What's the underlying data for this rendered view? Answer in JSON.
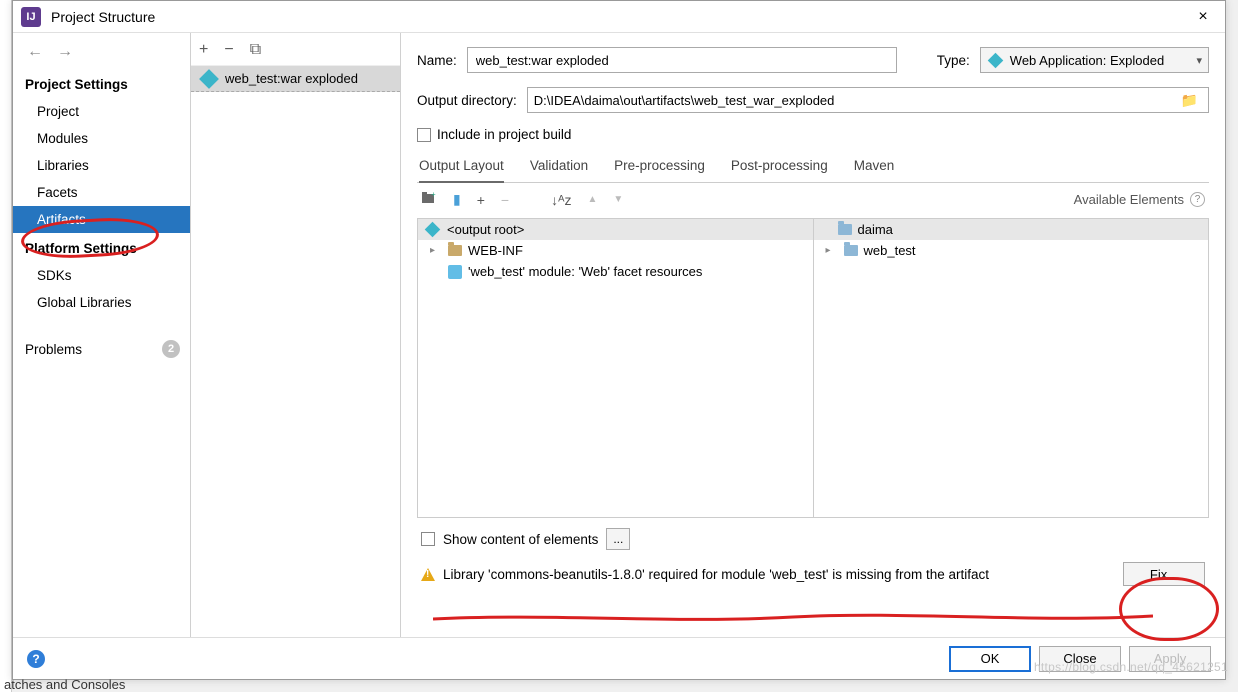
{
  "window": {
    "title": "Project Structure",
    "close": "×"
  },
  "sidebar": {
    "nav_back": "←",
    "nav_forward": "→",
    "group1_title": "Project Settings",
    "items1": [
      "Project",
      "Modules",
      "Libraries",
      "Facets",
      "Artifacts"
    ],
    "selected": "Artifacts",
    "group2_title": "Platform Settings",
    "items2": [
      "SDKs",
      "Global Libraries"
    ],
    "problems_label": "Problems",
    "problems_count": "2"
  },
  "mid": {
    "add": "+",
    "remove": "−",
    "copy": "⧉",
    "artifact_name": "web_test:war exploded"
  },
  "form": {
    "name_label": "Name:",
    "name_value": "web_test:war exploded",
    "type_label": "Type:",
    "type_value": "Web Application: Exploded",
    "outdir_label": "Output directory:",
    "outdir_value": "D:\\IDEA\\daima\\out\\artifacts\\web_test_war_exploded",
    "include_label": "Include in project build"
  },
  "tabs": {
    "items": [
      "Output Layout",
      "Validation",
      "Pre-processing",
      "Post-processing",
      "Maven"
    ],
    "active": "Output Layout"
  },
  "ol_toolbar": {
    "add_folder": "📁+",
    "jar": "▮",
    "add": "+",
    "remove": "−",
    "sort": "↓ᴬᴢ",
    "up": "▲",
    "down": "▼",
    "avail_label": "Available Elements",
    "help": "?"
  },
  "tree_left": {
    "root": "<output root>",
    "web_inf": "WEB-INF",
    "facet": "'web_test' module: 'Web' facet resources"
  },
  "tree_right": {
    "root": "daima",
    "child": "web_test"
  },
  "show_content_label": "Show content of elements",
  "dots": "...",
  "warning_text": "Library 'commons-beanutils-1.8.0' required for module 'web_test' is missing from the artifact",
  "fix_label": "Fix...",
  "buttons": {
    "ok": "OK",
    "close": "Close",
    "apply": "Apply",
    "help": "?"
  },
  "watermark": "https://blog.csdn.net/qq_45621251",
  "bottom_fragment": "atches and Consoles"
}
